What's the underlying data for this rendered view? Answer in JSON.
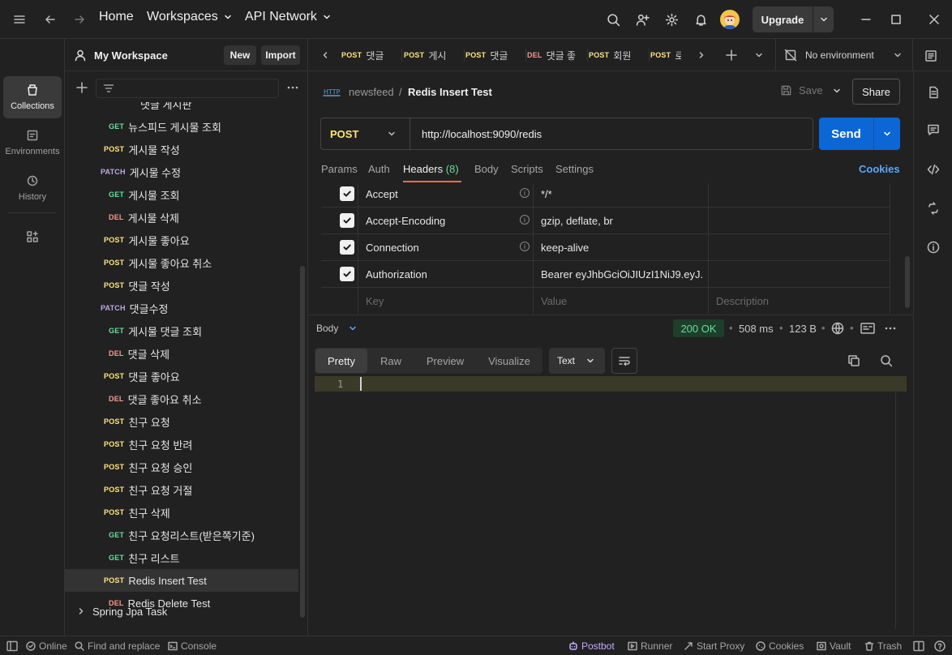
{
  "titlebar": {
    "home": "Home",
    "workspaces": "Workspaces",
    "api_network": "API Network",
    "upgrade": "Upgrade"
  },
  "rail": {
    "collections": "Collections",
    "environments": "Environments",
    "history": "History"
  },
  "sidebar": {
    "workspace": "My Workspace",
    "new": "New",
    "import": "Import",
    "items": [
      {
        "method": "",
        "name": "댓글 게시판"
      },
      {
        "method": "GET",
        "name": "뉴스피드 게시물 조회"
      },
      {
        "method": "POST",
        "name": "게시물 작성"
      },
      {
        "method": "PATCH",
        "name": "게시물 수정"
      },
      {
        "method": "GET",
        "name": "게시물 조회"
      },
      {
        "method": "DEL",
        "name": "게시물 삭제"
      },
      {
        "method": "POST",
        "name": "게시물 좋아요"
      },
      {
        "method": "POST",
        "name": "게시물 좋아요 취소"
      },
      {
        "method": "POST",
        "name": "댓글 작성"
      },
      {
        "method": "PATCH",
        "name": "댓글수정"
      },
      {
        "method": "GET",
        "name": "게시물 댓글 조회"
      },
      {
        "method": "DEL",
        "name": "댓글 삭제"
      },
      {
        "method": "POST",
        "name": "댓글 좋아요"
      },
      {
        "method": "DEL",
        "name": "댓글 좋아요 취소"
      },
      {
        "method": "POST",
        "name": "친구 요청"
      },
      {
        "method": "POST",
        "name": "친구 요청 반려"
      },
      {
        "method": "POST",
        "name": "친구 요청 승인"
      },
      {
        "method": "POST",
        "name": "친구 요청 거절"
      },
      {
        "method": "POST",
        "name": "친구 삭제"
      },
      {
        "method": "GET",
        "name": "친구 요청리스트(받은쪽기준)"
      },
      {
        "method": "GET",
        "name": "친구 리스트"
      },
      {
        "method": "POST",
        "name": "Redis Insert Test"
      },
      {
        "method": "DEL",
        "name": "Redis Delete Test"
      }
    ],
    "folder": "Spring Jpa Task"
  },
  "tabs": [
    {
      "method": "POST",
      "name": "댓글"
    },
    {
      "method": "POST",
      "name": "게시"
    },
    {
      "method": "POST",
      "name": "댓글"
    },
    {
      "method": "DEL",
      "name": "댓글 좋"
    },
    {
      "method": "POST",
      "name": "회원"
    },
    {
      "method": "POST",
      "name": "로"
    }
  ],
  "environment": "No environment",
  "request": {
    "collection": "newsfeed",
    "separator": "/",
    "name": "Redis Insert Test",
    "save": "Save",
    "share": "Share",
    "method": "POST",
    "url": "http://localhost:9090/redis",
    "send": "Send",
    "tabs": {
      "params": "Params",
      "auth": "Auth",
      "headers": "Headers",
      "headers_count": "(8)",
      "body": "Body",
      "scripts": "Scripts",
      "settings": "Settings"
    },
    "cookies": "Cookies",
    "headers": [
      {
        "key": "Accept",
        "value": "*/*"
      },
      {
        "key": "Accept-Encoding",
        "value": "gzip, deflate, br"
      },
      {
        "key": "Connection",
        "value": "keep-alive"
      },
      {
        "key": "Authorization",
        "value": "Bearer eyJhbGciOiJIUzI1NiJ9.eyJ..."
      }
    ],
    "placeholders": {
      "key": "Key",
      "value": "Value",
      "description": "Description"
    }
  },
  "response": {
    "label": "Body",
    "status": "200 OK",
    "time": "508 ms",
    "size": "123 B",
    "modes": {
      "pretty": "Pretty",
      "raw": "Raw",
      "preview": "Preview",
      "visualize": "Visualize"
    },
    "format": "Text",
    "line1": "1"
  },
  "statusbar": {
    "online": "Online",
    "find": "Find and replace",
    "console": "Console",
    "postbot": "Postbot",
    "runner": "Runner",
    "proxy": "Start Proxy",
    "cookies": "Cookies",
    "vault": "Vault",
    "trash": "Trash"
  },
  "colors": {
    "get": "#6bdd9a",
    "post": "#ffe47e",
    "patch": "#c0a8e1",
    "del": "#f79a8e",
    "send": "#0b67d6",
    "ok_bg": "#1d3e2a",
    "ok_fg": "#6bdd9a",
    "accent": "#ff6c37"
  }
}
